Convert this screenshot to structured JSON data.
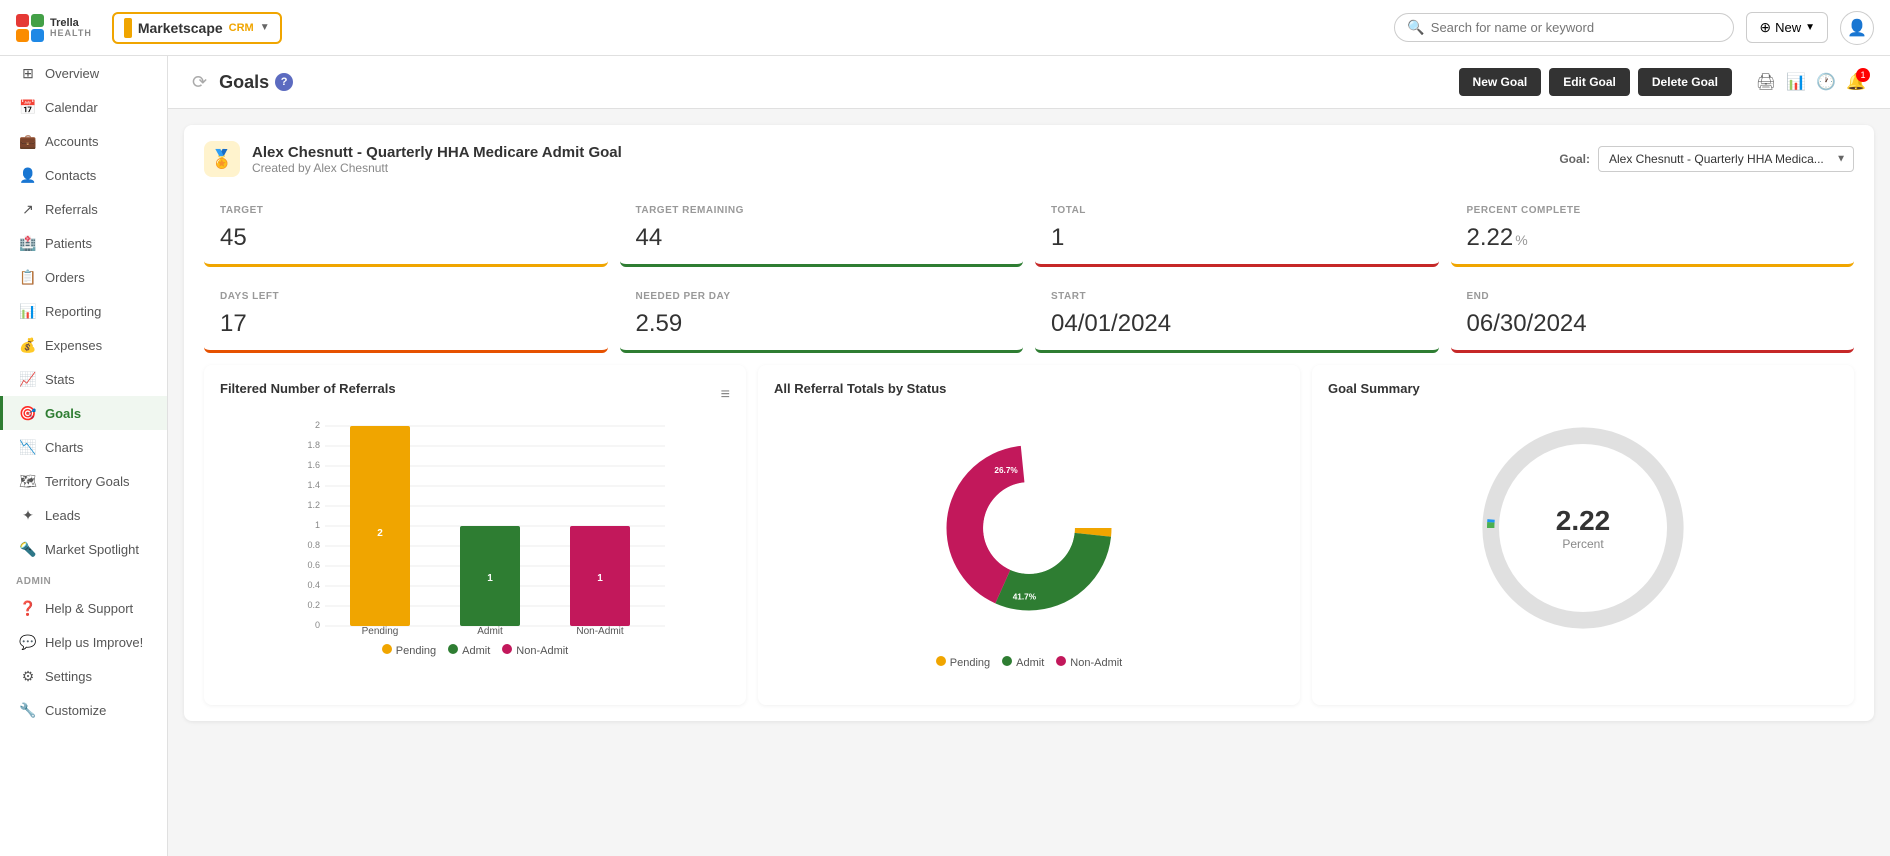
{
  "app": {
    "logo_text": "Trella\nHEALTH",
    "app_name": "Marketscape",
    "crm_badge": "CRM"
  },
  "header": {
    "search_placeholder": "Search for name or keyword",
    "new_label": "New",
    "user_icon": "👤"
  },
  "sidebar": {
    "items": [
      {
        "id": "overview",
        "label": "Overview",
        "icon": "⊞"
      },
      {
        "id": "calendar",
        "label": "Calendar",
        "icon": "📅"
      },
      {
        "id": "accounts",
        "label": "Accounts",
        "icon": "💼"
      },
      {
        "id": "contacts",
        "label": "Contacts",
        "icon": "👤"
      },
      {
        "id": "referrals",
        "label": "Referrals",
        "icon": "↗"
      },
      {
        "id": "patients",
        "label": "Patients",
        "icon": "🏥"
      },
      {
        "id": "orders",
        "label": "Orders",
        "icon": "📋"
      },
      {
        "id": "reporting",
        "label": "Reporting",
        "icon": "📊"
      },
      {
        "id": "expenses",
        "label": "Expenses",
        "icon": "💰"
      },
      {
        "id": "stats",
        "label": "Stats",
        "icon": "📈"
      },
      {
        "id": "goals",
        "label": "Goals",
        "icon": "🎯",
        "active": true
      },
      {
        "id": "charts",
        "label": "Charts",
        "icon": "📉"
      },
      {
        "id": "territory-goals",
        "label": "Territory Goals",
        "icon": "🗺"
      },
      {
        "id": "leads",
        "label": "Leads",
        "icon": "✦"
      },
      {
        "id": "market-spotlight",
        "label": "Market Spotlight",
        "icon": "🔦"
      }
    ],
    "admin_section": "ADMIN",
    "admin_items": [
      {
        "id": "help-support",
        "label": "Help & Support",
        "icon": "❓"
      },
      {
        "id": "help-improve",
        "label": "Help us Improve!",
        "icon": "💬"
      },
      {
        "id": "settings",
        "label": "Settings",
        "icon": "⚙"
      },
      {
        "id": "customize",
        "label": "Customize",
        "icon": "🔧"
      }
    ]
  },
  "goals_page": {
    "title": "Goals",
    "help_icon": "?",
    "buttons": {
      "new_goal": "New Goal",
      "edit_goal": "Edit Goal",
      "delete_goal": "Delete Goal"
    },
    "notification_count": "1",
    "goal_card": {
      "icon": "🏅",
      "title": "Alex Chesnutt - Quarterly HHA Medicare Admit Goal",
      "subtitle": "Created by Alex Chesnutt",
      "goal_label": "Goal:",
      "goal_selector_value": "Alex Chesnutt - Quarterly HHA Medica..."
    },
    "stats": [
      {
        "label": "TARGET",
        "value": "45",
        "unit": "",
        "color": "yellow"
      },
      {
        "label": "TARGET REMAINING",
        "value": "44",
        "unit": "",
        "color": "green"
      },
      {
        "label": "TOTAL",
        "value": "1",
        "unit": "",
        "color": "red"
      },
      {
        "label": "PERCENT COMPLETE",
        "value": "2.22",
        "unit": "%",
        "color": "yellow"
      },
      {
        "label": "DAYS LEFT",
        "value": "17",
        "unit": "",
        "color": "orange"
      },
      {
        "label": "NEEDED PER DAY",
        "value": "2.59",
        "unit": "",
        "color": "green"
      },
      {
        "label": "START",
        "value": "04/01/2024",
        "unit": "",
        "color": "green"
      },
      {
        "label": "END",
        "value": "06/30/2024",
        "unit": "",
        "color": "red"
      }
    ],
    "bar_chart": {
      "title": "Filtered Number of Referrals",
      "y_labels": [
        "0",
        "0.2",
        "0.4",
        "0.6",
        "0.8",
        "1",
        "1.2",
        "1.4",
        "1.6",
        "1.8",
        "2"
      ],
      "bars": [
        {
          "label": "Pending",
          "value": 2,
          "color": "#f0a500"
        },
        {
          "label": "Admit",
          "value": 1,
          "color": "#2e7d32"
        },
        {
          "label": "Non-Admit",
          "value": 1,
          "color": "#c2185b"
        }
      ],
      "legend": [
        {
          "label": "Pending",
          "color": "#f0a500"
        },
        {
          "label": "Admit",
          "color": "#2e7d32"
        },
        {
          "label": "Non-Admit",
          "color": "#c2185b"
        }
      ]
    },
    "donut_chart": {
      "title": "All Referral Totals by Status",
      "segments": [
        {
          "label": "Pending",
          "percent": 26.7,
          "color": "#f0a500"
        },
        {
          "label": "Admit",
          "percent": 30.0,
          "color": "#2e7d32"
        },
        {
          "label": "Non-Admit",
          "percent": 41.7,
          "color": "#c2185b"
        }
      ],
      "legend": [
        {
          "label": "Pending",
          "color": "#f0a500"
        },
        {
          "label": "Admit",
          "color": "#2e7d32"
        },
        {
          "label": "Non-Admit",
          "color": "#c2185b"
        }
      ]
    },
    "gauge_chart": {
      "title": "Goal Summary",
      "value": "2.22",
      "label": "Percent",
      "segments": [
        {
          "color": "#4caf50",
          "value": 2.22
        },
        {
          "color": "#2196f3",
          "value": 0.5
        }
      ]
    }
  }
}
